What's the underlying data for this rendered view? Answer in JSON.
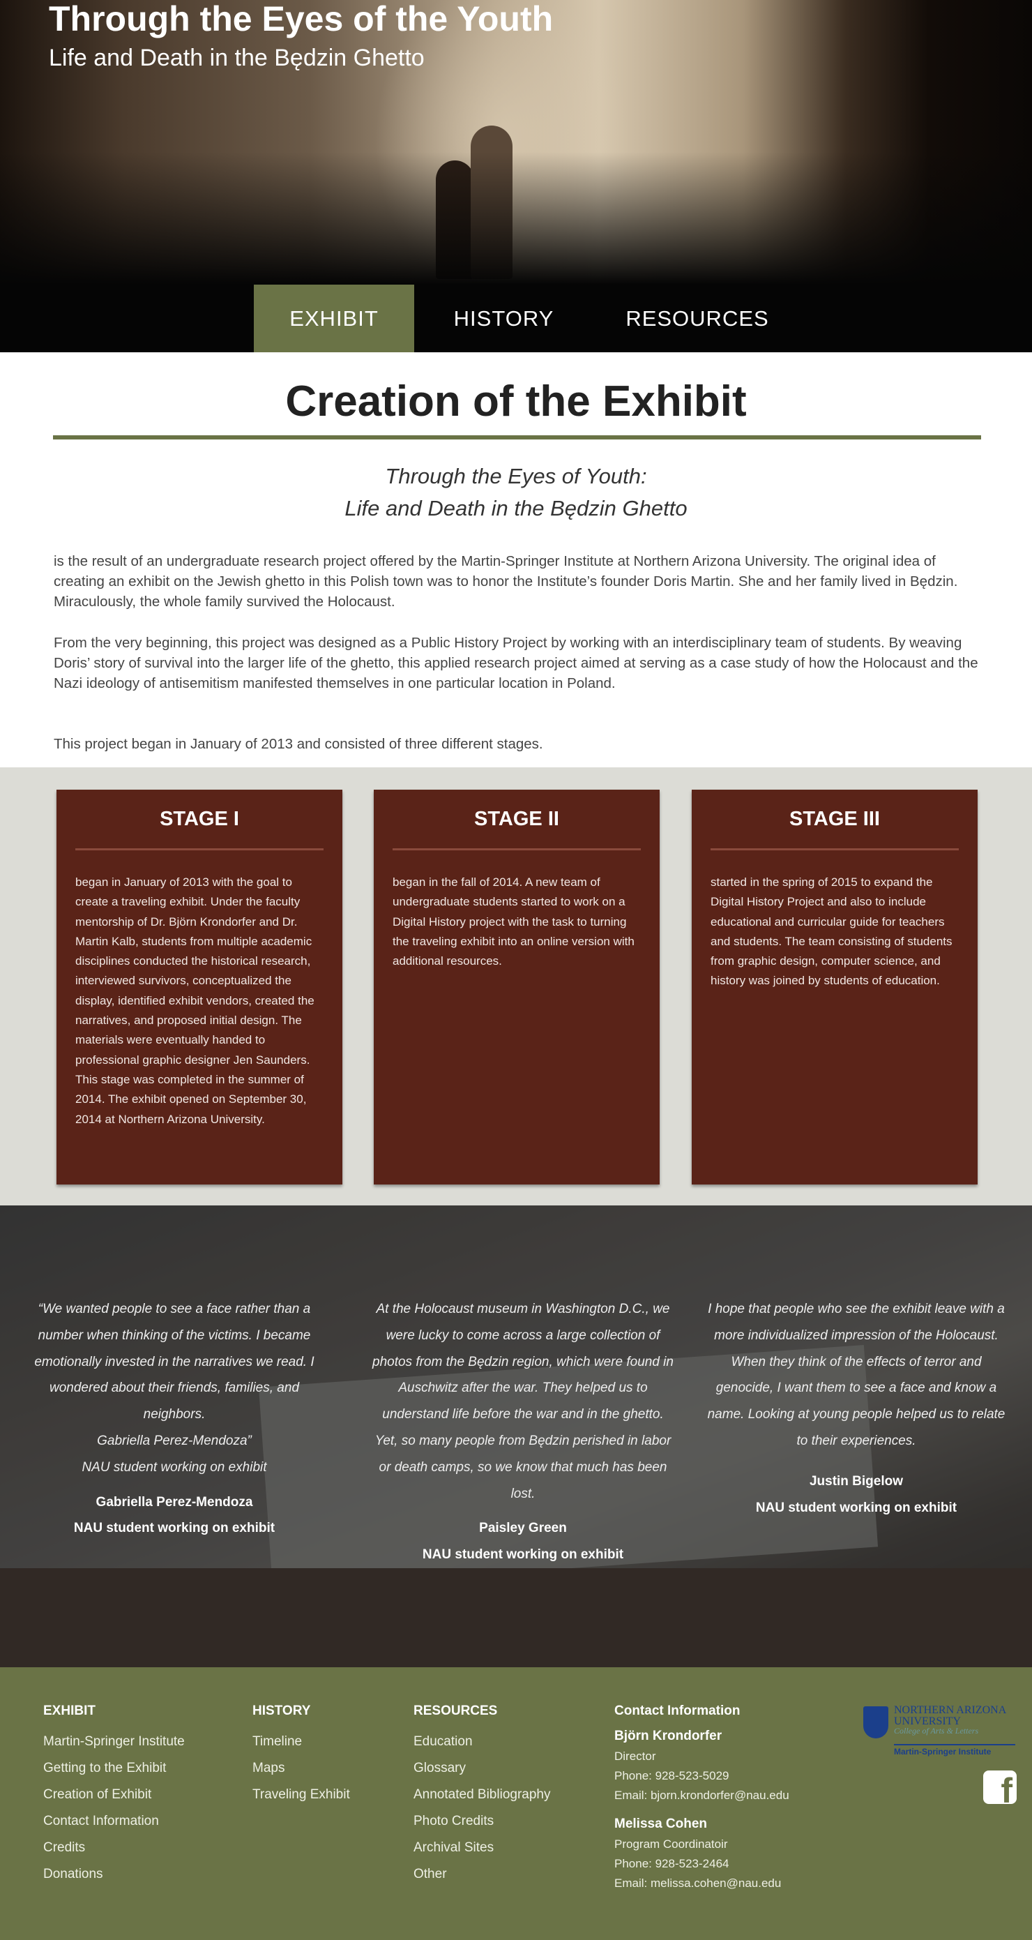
{
  "header": {
    "title": "Through the Eyes of the Youth",
    "subtitle": "Life and Death in the Będzin Ghetto"
  },
  "nav": {
    "items": [
      {
        "label": "EXHIBIT",
        "active": true
      },
      {
        "label": "HISTORY",
        "active": false
      },
      {
        "label": "RESOURCES",
        "active": false
      }
    ]
  },
  "main": {
    "title": "Creation of the Exhibit",
    "subtitle_line1": "Through the Eyes of Youth:",
    "subtitle_line2": "Life and Death in the Będzin Ghetto",
    "paragraphs": [
      "is the result of an undergraduate research project offered by the Martin-Springer Institute at Northern Arizona University. The original idea of creating an exhibit on the Jewish ghetto in this Polish town was to honor the Institute’s founder Doris Martin. She and her family lived in Będzin. Miraculously, the whole family survived the Holocaust.",
      "From the very beginning, this project was designed as a Public History Project by working with an interdisciplinary team of students. By weaving Doris’ story of survival into the larger life of the ghetto, this applied research project aimed at serving as a case study of how the Holocaust and the Nazi ideology of antisemitism manifested themselves in one particular location in Poland.",
      "This project began in January of 2013 and consisted of three different stages."
    ]
  },
  "stages": [
    {
      "title": "STAGE I",
      "text": "began in January of 2013 with the goal to create a traveling exhibit. Under the faculty mentorship of Dr. Björn Krondorfer and Dr. Martin Kalb, students from multiple academic disciplines conducted the historical research, interviewed survivors, conceptualized the display, identified exhibit vendors, created the narratives, and proposed initial design. The materials were eventually handed to professional graphic designer Jen Saunders. This stage was completed in the summer of 2014. The exhibit opened on September 30, 2014 at Northern Arizona University."
    },
    {
      "title": "STAGE II",
      "text": "began in the fall of 2014. A new team of undergraduate students started to work on a Digital History project with the task to turning the traveling exhibit into an online version with additional resources."
    },
    {
      "title": "STAGE III",
      "text": "started in the spring of 2015 to expand the Digital History Project and also to include educational and curricular guide for teachers and students. The team consisting of students from graphic design, computer science, and history was joined by students of education."
    }
  ],
  "quotes": [
    {
      "text": "“We wanted people to see a face rather than a number when thinking of the victims. I became emotionally invested in the narratives we read. I wondered about their friends, families, and neighbors.\nGabriella Perez-Mendoza”\nNAU student working on exhibit",
      "name": "Gabriella Perez-Mendoza",
      "role": "NAU student working on exhibit"
    },
    {
      "text": "At the Holocaust museum in Washington D.C., we were lucky to come across a large collection of photos from the Będzin region, which were found in Auschwitz after the war. They helped us to understand life before the war and in the ghetto. Yet, so many people from Będzin perished in labor or death camps, so we know that much has been lost.",
      "name": "Paisley Green",
      "role": "NAU student working on exhibit"
    },
    {
      "text": "I hope that people who see the exhibit leave with a more individualized impression of the Holocaust. When they think of the effects of terror and genocide, I want them to see a face and know a name. Looking at young people helped us to relate to their experiences.",
      "name": "Justin Bigelow",
      "role": "NAU student working on exhibit"
    }
  ],
  "footer": {
    "exhibit": {
      "heading": "EXHIBIT",
      "links": [
        "Martin-Springer Institute",
        "Getting to the Exhibit",
        "Creation of Exhibit",
        "Contact Information",
        "Credits",
        "Donations"
      ]
    },
    "history": {
      "heading": "HISTORY",
      "links": [
        "Timeline",
        "Maps",
        "Traveling Exhibit"
      ]
    },
    "resources": {
      "heading": "RESOURCES",
      "links": [
        "Education",
        "Glossary",
        "Annotated Bibliography",
        "Photo Credits",
        "Archival Sites",
        "Other"
      ]
    },
    "contact": {
      "heading": "Contact Information",
      "people": [
        {
          "name": "Björn Krondorfer",
          "title": "Director",
          "phone": "Phone: 928-523-5029",
          "email": "Email: bjorn.krondorfer@nau.edu"
        },
        {
          "name": "Melissa Cohen",
          "title": "Program Coordinatoir",
          "phone": "Phone: 928-523-2464",
          "email": "Email: melissa.cohen@nau.edu"
        }
      ]
    },
    "logo": {
      "line1": "NORTHERN ARIZONA",
      "line2": "UNIVERSITY",
      "line3": "College of Arts & Letters",
      "line4": "Martin-Springer Institute"
    },
    "facebook_icon": "facebook-icon",
    "colors": {
      "olive": "#6a7346",
      "stage_card": "#5a2318",
      "stage_bg": "#dcdcd6"
    }
  }
}
